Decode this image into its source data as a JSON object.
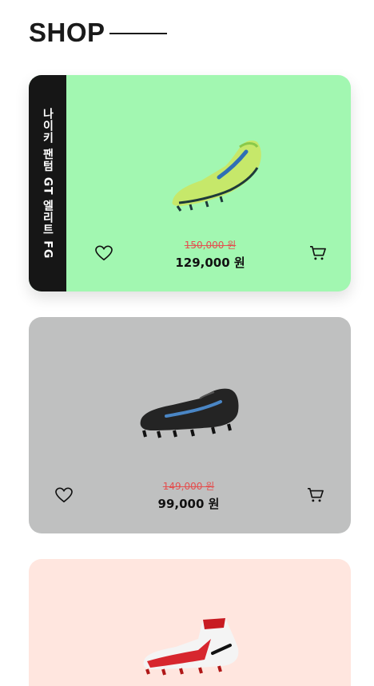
{
  "header": {
    "title": "SHOP"
  },
  "products": [
    {
      "name": "나이키 팬텀 GT 엘리트 FG",
      "old_price": "150,000 원",
      "price": "129,000 원",
      "background": "#a2f7b1",
      "image_icon": "green-soccer-cleat"
    },
    {
      "name": "",
      "old_price": "149,000 원",
      "price": "99,000 원",
      "background": "#bfc0c0",
      "image_icon": "black-soccer-cleat"
    },
    {
      "name": "",
      "background": "#ffe6df",
      "image_icon": "red-white-high-top-cleat"
    }
  ],
  "icons": {
    "wishlist": "heart-icon",
    "cart": "cart-icon"
  }
}
